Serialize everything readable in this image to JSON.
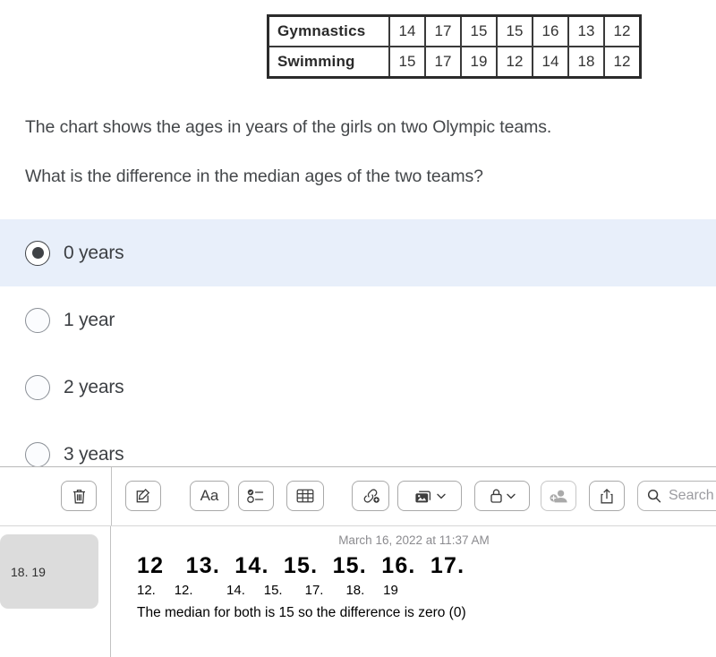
{
  "quiz": {
    "table": {
      "rows": [
        {
          "label": "Gymnastics",
          "values": [
            "14",
            "17",
            "15",
            "15",
            "16",
            "13",
            "12"
          ]
        },
        {
          "label": "Swimming",
          "values": [
            "15",
            "17",
            "19",
            "12",
            "14",
            "18",
            "12"
          ]
        }
      ]
    },
    "prompt_line_1": "The chart shows the ages in years of the girls on two Olympic teams.",
    "prompt_line_2": "What is the difference in the median ages of the two teams?",
    "options": [
      {
        "label": "0 years",
        "selected": true
      },
      {
        "label": "1 year",
        "selected": false
      },
      {
        "label": "2 years",
        "selected": false
      },
      {
        "label": "3 years",
        "selected": false
      }
    ],
    "selected_highlight_color": "#e8effa"
  },
  "notes": {
    "toolbar": {
      "delete_label": "Delete",
      "compose_label": "New Note",
      "format_label": "Aa",
      "checklist_label": "Checklist",
      "table_label": "Table",
      "link_label": "Add Link",
      "media_label": "Media",
      "lock_label": "Lock",
      "collaborate_label": "Collaborate",
      "share_label": "Share",
      "search_placeholder": "Search"
    },
    "list": [
      {
        "title": "18. 19",
        "selected": true
      }
    ],
    "note": {
      "date": "March 16, 2022 at 11:37 AM",
      "line_1": "12   13.  14.  15.  15.  16.  17.",
      "line_2": "12.     12.         14.     15.      17.      18.     19",
      "line_3": "The median for both is 15 so the difference is zero (0)"
    }
  }
}
